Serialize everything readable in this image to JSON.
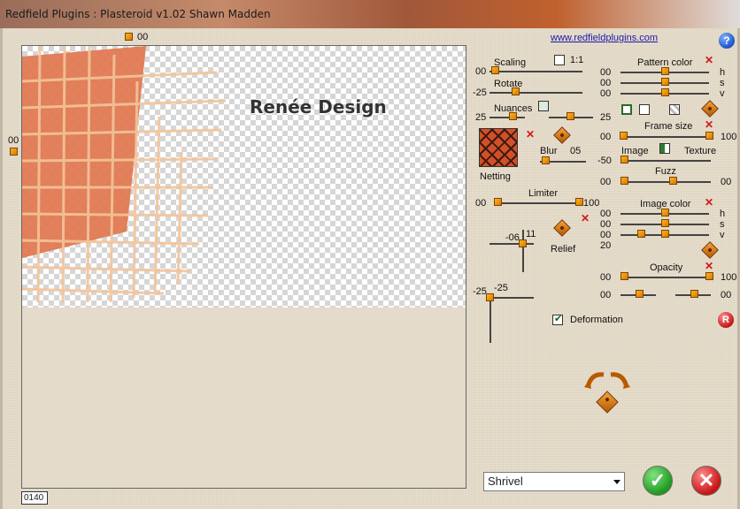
{
  "window": {
    "title": "Redfield Plugins : Plasteroid v1.02   Shawn Madden"
  },
  "header": {
    "link": "www.redfieldplugins.com",
    "help": "?"
  },
  "preview": {
    "top_ruler_value": "00",
    "left_ruler_value": "00",
    "watermark": "Renée Design",
    "status_value": "0140"
  },
  "left_panel": {
    "scaling": {
      "label": "Scaling",
      "value": "00",
      "checkbox_label": "1:1"
    },
    "rotate": {
      "label": "Rotate",
      "value": "-25"
    },
    "nuances": {
      "label": "Nuances",
      "left_value": "25",
      "right_value": "25"
    },
    "pattern_name": "Netting",
    "blur": {
      "label": "Blur",
      "value": "05"
    },
    "limiter": {
      "label": "Limiter",
      "left_value": "00",
      "right_value": "100"
    },
    "relief": {
      "label": "Relief",
      "h_value": "-06",
      "v_value": "11"
    },
    "light": {
      "h_value": "-25",
      "v_value": "-25"
    },
    "deformation": {
      "label": "Deformation",
      "checked": true
    }
  },
  "right_panel": {
    "pattern_color": {
      "label": "Pattern color",
      "h": "00",
      "s": "00",
      "v": "00",
      "h_label": "h",
      "s_label": "s",
      "v_label": "v"
    },
    "frame_size": {
      "label": "Frame size",
      "left_value": "00",
      "right_value": "100"
    },
    "image_texture": {
      "left_value": "-50",
      "image_label": "Image",
      "texture_label": "Texture"
    },
    "fuzz": {
      "label": "Fuzz",
      "left_value": "00",
      "right_value": "00"
    },
    "image_color": {
      "label": "Image color",
      "h": "00",
      "s": "00",
      "v": "00",
      "extra": "20",
      "h_label": "h",
      "s_label": "s",
      "v_label": "v"
    },
    "opacity": {
      "label": "Opacity",
      "left_value": "00",
      "right_value": "100",
      "row2_left": "00",
      "row2_right": "00"
    }
  },
  "footer": {
    "preset_selected": "Shrivel"
  },
  "colors": {
    "accent_orange": "#f5a13a",
    "swatch": "#d24f28",
    "ok": "#1f9a1f",
    "cancel": "#c61515",
    "link": "#1a1aa8"
  }
}
